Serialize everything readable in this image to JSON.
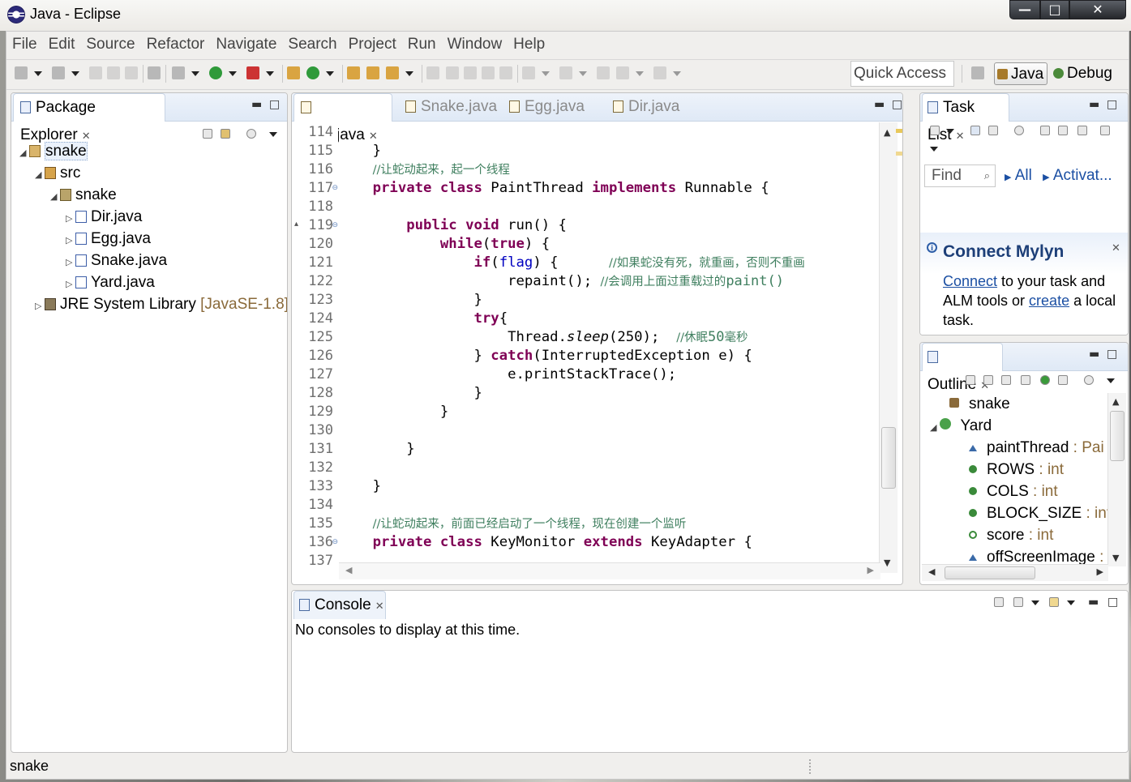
{
  "window": {
    "title": "Java - Eclipse",
    "buttons": {
      "minimize": "—",
      "maximize": "□",
      "close": "✕"
    }
  },
  "menu": [
    "File",
    "Edit",
    "Source",
    "Refactor",
    "Navigate",
    "Search",
    "Project",
    "Run",
    "Window",
    "Help"
  ],
  "toolbar": {
    "quick_access": "Quick Access",
    "perspectives": {
      "java": "Java",
      "debug": "Debug"
    }
  },
  "package_explorer": {
    "tab": "Package Explorer",
    "tree": [
      {
        "label": "snake",
        "level": 0,
        "expanded": true,
        "type": "project",
        "selected": true
      },
      {
        "label": "src",
        "level": 1,
        "expanded": true,
        "type": "source-folder"
      },
      {
        "label": "snake",
        "level": 2,
        "expanded": true,
        "type": "package"
      },
      {
        "label": "Dir.java",
        "level": 3,
        "expanded": false,
        "type": "java"
      },
      {
        "label": "Egg.java",
        "level": 3,
        "expanded": false,
        "type": "java"
      },
      {
        "label": "Snake.java",
        "level": 3,
        "expanded": false,
        "type": "java"
      },
      {
        "label": "Yard.java",
        "level": 3,
        "expanded": false,
        "type": "java"
      },
      {
        "label": "JRE System Library",
        "suffix": "[JavaSE-1.8]",
        "level": 1,
        "expanded": false,
        "type": "library"
      }
    ]
  },
  "editor": {
    "tabs": [
      {
        "label": "Yard.java",
        "active": true
      },
      {
        "label": "Snake.java",
        "active": false
      },
      {
        "label": "Egg.java",
        "active": false
      },
      {
        "label": "Dir.java",
        "active": false
      }
    ],
    "lines": [
      {
        "n": "114",
        "code": ""
      },
      {
        "n": "115",
        "code": "    }"
      },
      {
        "n": "116",
        "code": "    <span class=\"cm\">//让蛇动起来，起一个线程</span>"
      },
      {
        "n": "117",
        "fold": true,
        "code": "    <span class=\"kw\">private class</span> PaintThread <span class=\"kw\">implements</span> Runnable {"
      },
      {
        "n": "118",
        "code": ""
      },
      {
        "n": "119",
        "fold": true,
        "override": true,
        "code": "        <span class=\"kw\">public void</span> run() {"
      },
      {
        "n": "120",
        "code": "            <span class=\"kw\">while</span>(<span class=\"kw\">true</span>) {"
      },
      {
        "n": "121",
        "code": "                <span class=\"kw\">if</span>(<span class=\"fld\">flag</span>) {      <span class=\"cm\">//如果蛇没有死，就重画，否则不重画</span>"
      },
      {
        "n": "122",
        "code": "                    repaint(); <span class=\"cm\">//会调用上面过重载过的</span><span class=\"cm\" style=\"font-family:'DejaVu Sans Mono',monospace;font-size:17px\">paint()</span>"
      },
      {
        "n": "123",
        "code": "                }"
      },
      {
        "n": "124",
        "code": "                <span class=\"kw\">try</span>{"
      },
      {
        "n": "125",
        "code": "                    Thread.<span class=\"it\">sleep</span>(250);  <span class=\"cm\">//休眠</span><span class=\"cm\" style=\"font-family:'DejaVu Sans Mono',monospace;font-size:17px\">50</span><span class=\"cm\">毫秒</span>"
      },
      {
        "n": "126",
        "code": "                } <span class=\"kw\">catch</span>(InterruptedException e) {"
      },
      {
        "n": "127",
        "code": "                    e.printStackTrace();"
      },
      {
        "n": "128",
        "code": "                }"
      },
      {
        "n": "129",
        "code": "            }"
      },
      {
        "n": "130",
        "code": ""
      },
      {
        "n": "131",
        "code": "        }"
      },
      {
        "n": "132",
        "code": ""
      },
      {
        "n": "133",
        "code": "    }"
      },
      {
        "n": "134",
        "code": ""
      },
      {
        "n": "135",
        "code": "    <span class=\"cm\">//让蛇动起来，前面已经启动了一个线程，现在创建一个监听</span>"
      },
      {
        "n": "136",
        "fold": true,
        "code": "    <span class=\"kw\">private class</span> KeyMonitor <span class=\"kw\">extends</span> KeyAdapter {"
      },
      {
        "n": "137",
        "code": ""
      }
    ]
  },
  "task_list": {
    "tab": "Task List",
    "find_placeholder": "Find",
    "all": "All",
    "activate": "Activat..."
  },
  "mylyn": {
    "title": "Connect Mylyn",
    "link_connect": "Connect",
    "text1": " to your task and ALM tools or ",
    "link_create": "create",
    "text2": " a local task."
  },
  "outline": {
    "tab": "Outline",
    "items": [
      {
        "label": "snake",
        "type": "",
        "indent": 1,
        "icon": "package"
      },
      {
        "label": "Yard",
        "type": "",
        "indent": 0,
        "icon": "class",
        "expanded": true
      },
      {
        "label": "paintThread",
        "type": " : Pai",
        "indent": 2,
        "icon": "field-tri"
      },
      {
        "label": "ROWS",
        "type": " : int",
        "indent": 2,
        "icon": "static-final"
      },
      {
        "label": "COLS",
        "type": " : int",
        "indent": 2,
        "icon": "static-final"
      },
      {
        "label": "BLOCK_SIZE",
        "type": " : int",
        "indent": 2,
        "icon": "static-final"
      },
      {
        "label": "score",
        "type": " : int",
        "indent": 2,
        "icon": "field"
      },
      {
        "label": "offScreenImage",
        "type": " :",
        "indent": 2,
        "icon": "field-tri"
      }
    ]
  },
  "console": {
    "tab": "Console",
    "message": "No consoles to display at this time."
  },
  "status_bar": {
    "text": "snake"
  }
}
